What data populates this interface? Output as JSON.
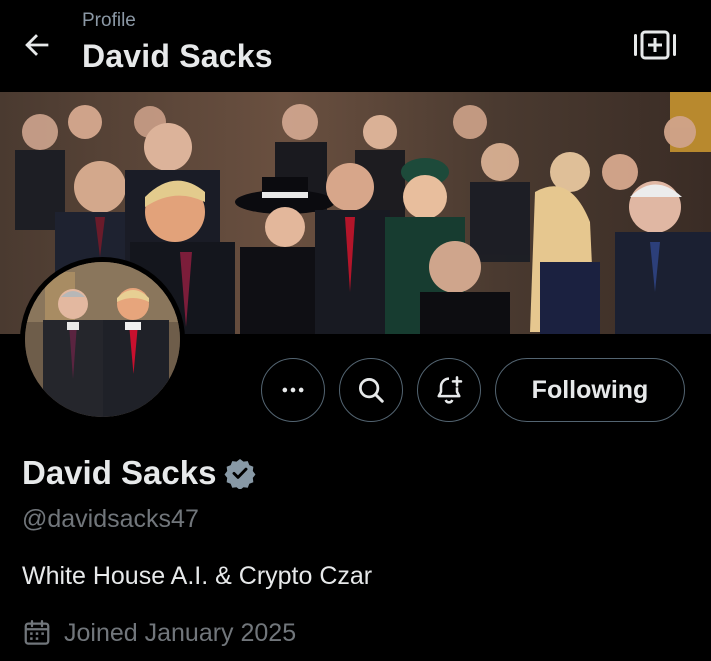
{
  "header": {
    "subtitle": "Profile",
    "title": "David Sacks"
  },
  "icons": {
    "back": "arrow-left-icon",
    "grok": "grok-icon",
    "more": "more-horizontal-icon",
    "search": "search-icon",
    "notify": "bell-plus-icon",
    "verified": "verified-badge-icon",
    "calendar": "calendar-icon"
  },
  "actions": {
    "follow_label": "Following"
  },
  "profile": {
    "name": "David Sacks",
    "handle": "@davidsacks47",
    "bio": "White House A.I. & Crypto Czar",
    "joined": "Joined January 2025"
  },
  "colors": {
    "background": "#000000",
    "primary_text": "#e7e9ea",
    "secondary_text": "#71767b",
    "border": "#536471",
    "verified": "#8899a6"
  }
}
